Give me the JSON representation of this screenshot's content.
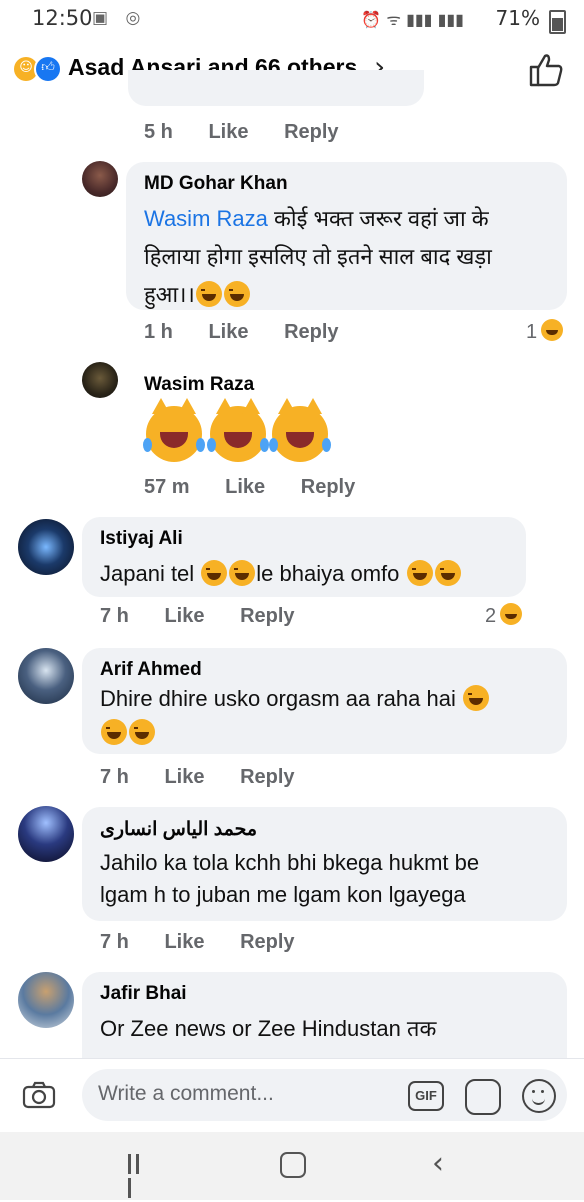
{
  "status_bar": {
    "time": "12:50",
    "battery": "71%"
  },
  "header": {
    "title": "Asad Ansari and 66 others",
    "reactions": [
      "haha-icon",
      "like-icon"
    ]
  },
  "comments": [
    {
      "id": "reply-1",
      "meta": {
        "age": "5 h",
        "like": "Like",
        "reply": "Reply"
      }
    },
    {
      "id": "reply-2",
      "author": "MD Gohar Khan",
      "mention": "Wasim Raza",
      "line1": " कोई भक्त जरूर वहां जा के",
      "line2": "हिलाया होगा इसलिए तो इतने साल बाद खड़ा",
      "line3": "हुआ।।",
      "meta": {
        "age": "1 h",
        "like": "Like",
        "reply": "Reply"
      },
      "reaction_count": "1"
    },
    {
      "id": "reply-3",
      "author": "Wasim Raza",
      "meta": {
        "age": "57 m",
        "like": "Like",
        "reply": "Reply"
      }
    },
    {
      "id": "comment-istiyaj",
      "author": "Istiyaj Ali",
      "text_a": "Japani tel ",
      "text_b": "le bhaiya omfo ",
      "meta": {
        "age": "7 h",
        "like": "Like",
        "reply": "Reply"
      },
      "reaction_count": "2"
    },
    {
      "id": "comment-arif",
      "author": "Arif Ahmed",
      "text": "Dhire dhire usko orgasm aa raha hai ",
      "meta": {
        "age": "7 h",
        "like": "Like",
        "reply": "Reply"
      }
    },
    {
      "id": "comment-ilyas",
      "author": "محمد الیاس انساری",
      "line1": "Jahilo ka tola kchh bhi bkega hukmt be",
      "line2": "lgam h to juban me lgam kon lgayega",
      "meta": {
        "age": "7 h",
        "like": "Like",
        "reply": "Reply"
      }
    },
    {
      "id": "comment-jafir",
      "author": "Jafir Bhai",
      "line1": "Or Zee news or Zee Hindustan तक"
    }
  ],
  "composer": {
    "placeholder": "Write a comment...",
    "gif_label": "GIF"
  },
  "colors": {
    "accent": "#1877f2",
    "mention": "#1b74e4",
    "bubble": "#f0f2f5",
    "meta": "#65676b",
    "haha": "#f7b125"
  }
}
